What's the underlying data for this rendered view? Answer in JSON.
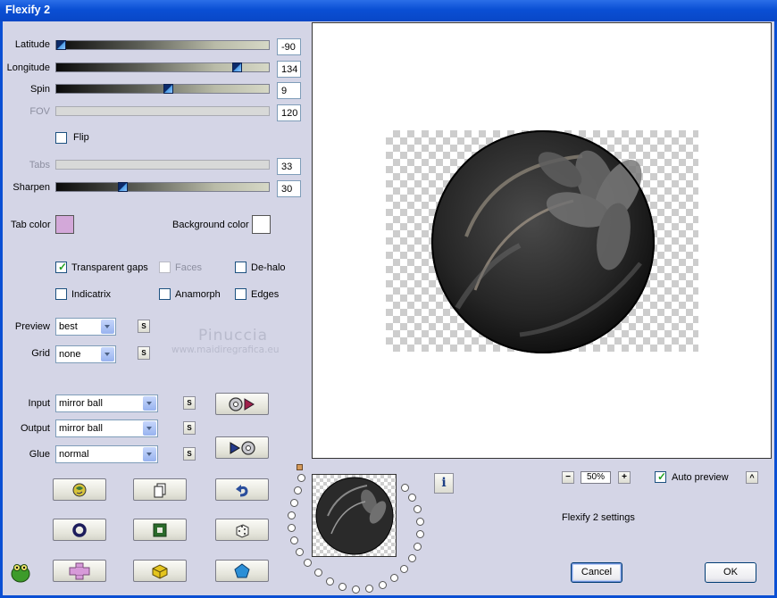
{
  "window": {
    "title": "Flexify 2"
  },
  "params": [
    {
      "label": "Latitude",
      "value": "-90",
      "enabled": true,
      "level": 0.0
    },
    {
      "label": "Longitude",
      "value": "134",
      "enabled": true,
      "level": 0.87
    },
    {
      "label": "Spin",
      "value": "9",
      "enabled": true,
      "level": 0.51
    },
    {
      "label": "FOV",
      "value": "120",
      "enabled": false
    },
    {
      "label": "Tabs",
      "value": "33",
      "enabled": false
    },
    {
      "label": "Sharpen",
      "value": "30",
      "enabled": true,
      "level": 0.3
    }
  ],
  "flip": {
    "label": "Flip",
    "checked": false
  },
  "tab_color": {
    "label": "Tab color",
    "color": "#d3a8d9"
  },
  "background_color": {
    "label": "Background color",
    "color": "#ffffff"
  },
  "options": {
    "transparent_gaps": {
      "label": "Transparent gaps",
      "checked": true
    },
    "faces": {
      "label": "Faces",
      "checked": false,
      "enabled": false
    },
    "de_halo": {
      "label": "De-halo",
      "checked": false
    },
    "indicatrix": {
      "label": "Indicatrix",
      "checked": false
    },
    "anamorph": {
      "label": "Anamorph",
      "checked": false
    },
    "edges": {
      "label": "Edges",
      "checked": false
    }
  },
  "preview": {
    "label": "Preview",
    "value": "best",
    "s": "S"
  },
  "grid": {
    "label": "Grid",
    "value": "none",
    "s": "S"
  },
  "input": {
    "label": "Input",
    "value": "mirror ball",
    "s": "S"
  },
  "output": {
    "label": "Output",
    "value": "mirror ball",
    "s": "S"
  },
  "glue": {
    "label": "Glue",
    "value": "normal",
    "s": "S"
  },
  "watermark": {
    "line1": "Pinuccia",
    "line2": "www.maidiregrafica.eu"
  },
  "zoom": {
    "value": "50%",
    "minus": "−",
    "plus": "+"
  },
  "auto_preview": {
    "label": "Auto preview",
    "checked": true,
    "btn": "^"
  },
  "settings_label": "Flexify 2 settings",
  "info_label": "i",
  "cancel_label": "Cancel",
  "ok_label": "OK",
  "colors": {
    "title_bar": "#0a4fd4",
    "dialog_bg": "#d4d5e6"
  }
}
